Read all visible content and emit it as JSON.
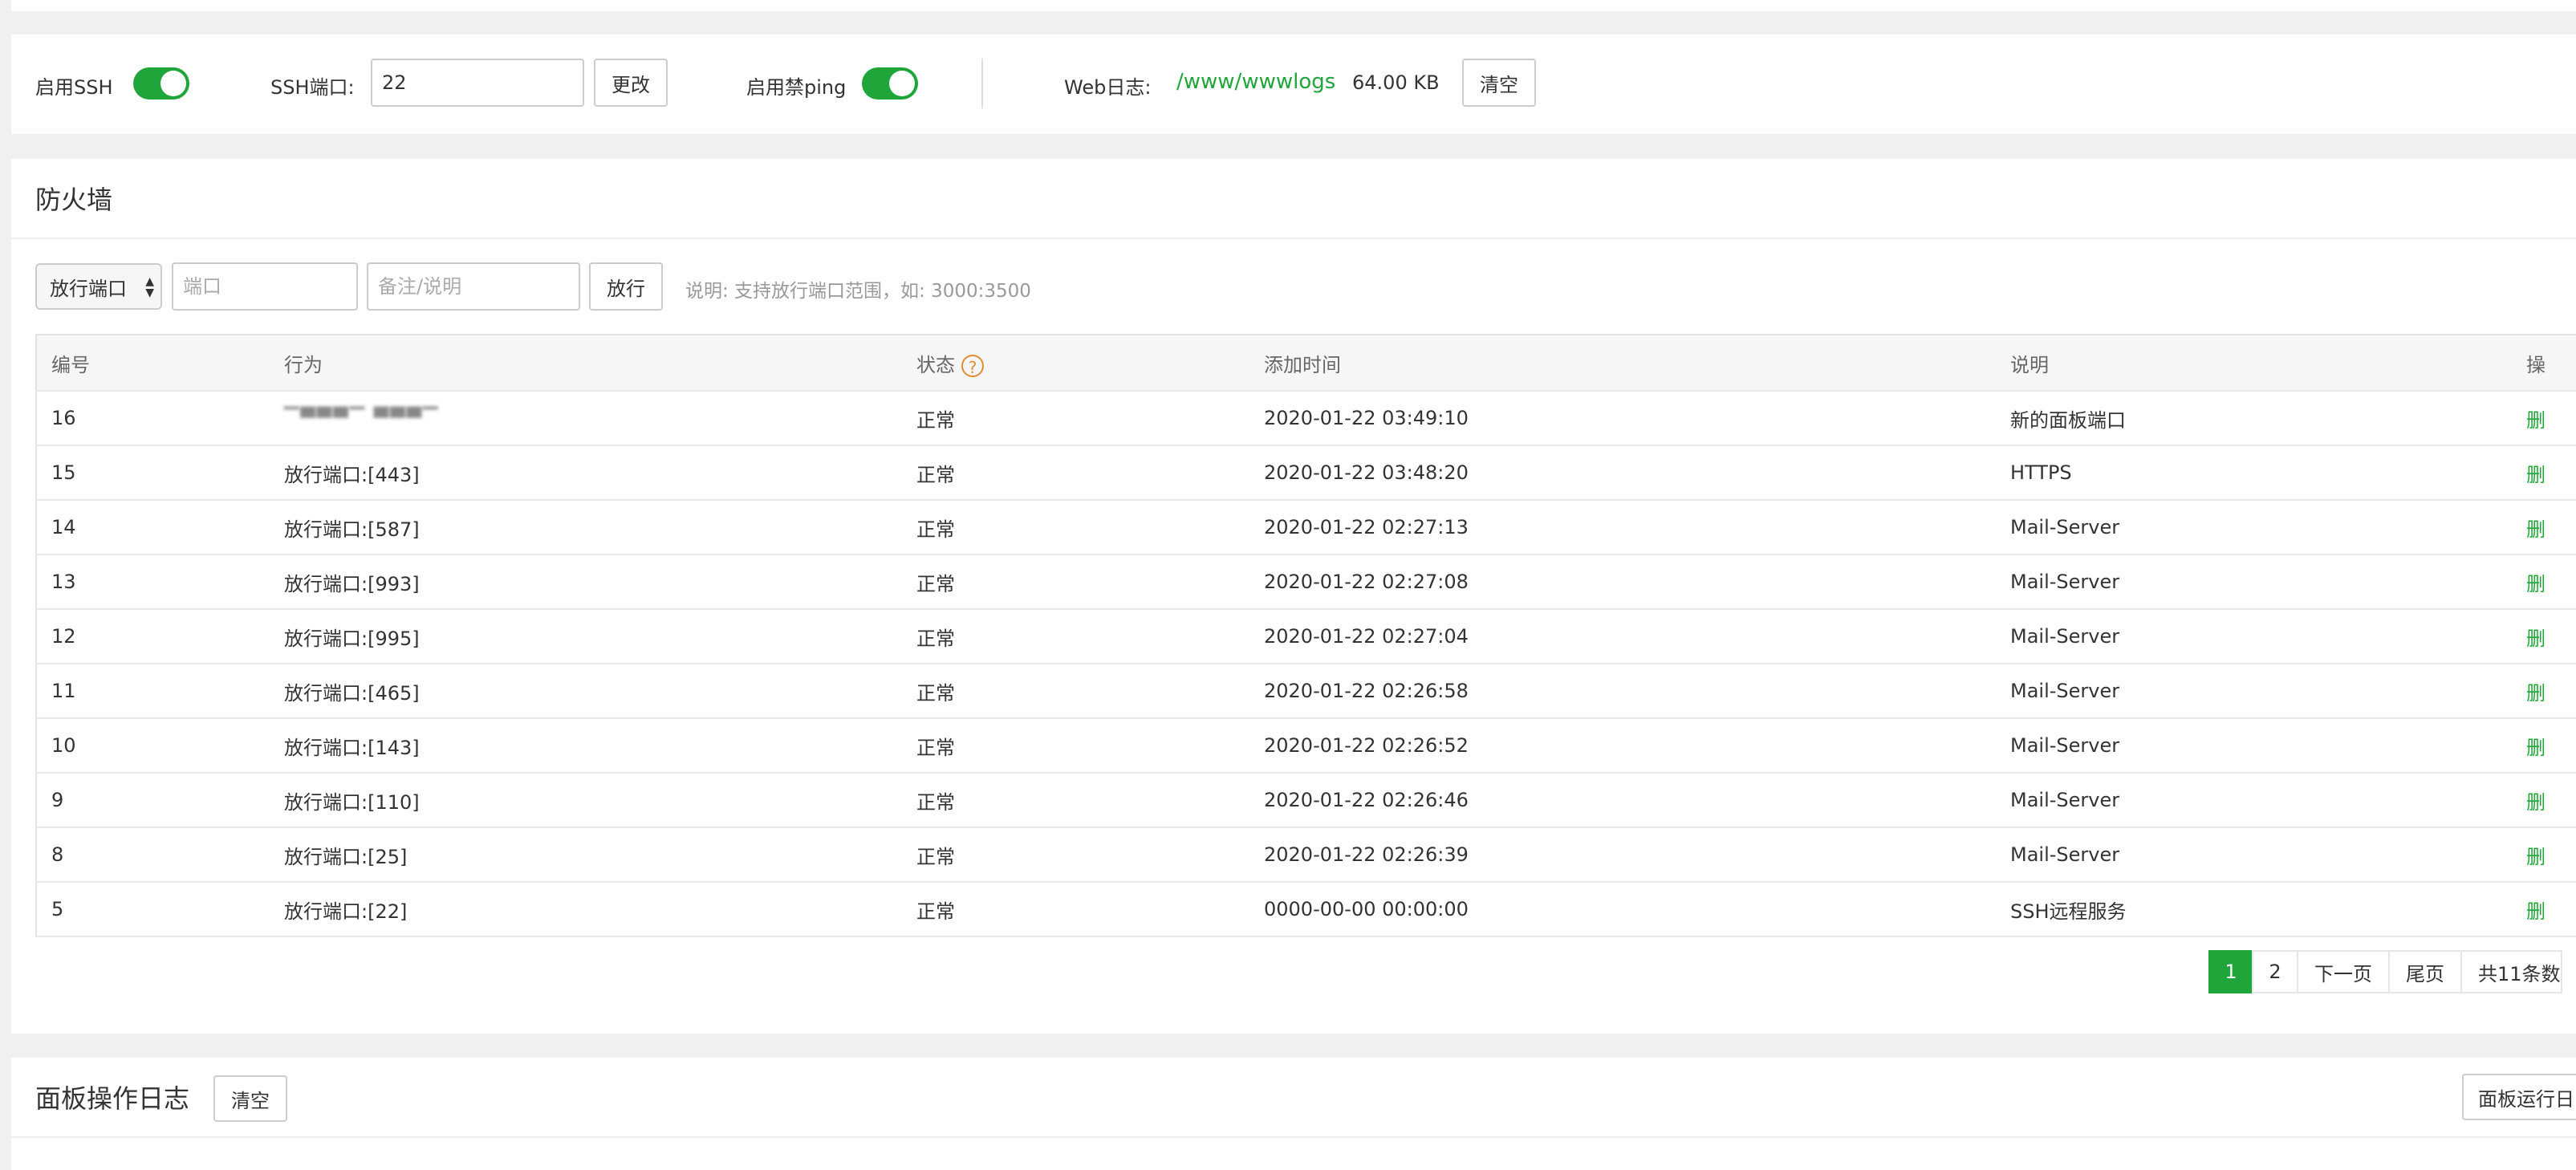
{
  "settings": {
    "ssh_label": "启用SSH",
    "ssh_enabled": true,
    "ssh_port_label": "SSH端口:",
    "ssh_port_value": "22",
    "change_button": "更改",
    "noping_label": "启用禁ping",
    "noping_enabled": true,
    "weblog_label": "Web日志:",
    "weblog_path": "/www/wwwlogs",
    "weblog_size": "64.00 KB",
    "clear_button": "清空"
  },
  "firewall": {
    "title": "防火墙",
    "select_value": "放行端口",
    "port_placeholder": "端口",
    "note_placeholder": "备注/说明",
    "allow_button": "放行",
    "hint": "说明: 支持放行端口范围，如: 3000:3500",
    "columns": [
      "编号",
      "行为",
      "状态",
      "添加时间",
      "说明",
      "操"
    ],
    "rows": [
      {
        "id": "16",
        "action": "▔▀▀▀▔ ▀▀▀▔",
        "status": "正常",
        "time": "2020-01-22 03:49:10",
        "desc": "新的面板端口",
        "op": "删"
      },
      {
        "id": "15",
        "action": "放行端口:[443]",
        "status": "正常",
        "time": "2020-01-22 03:48:20",
        "desc": "HTTPS",
        "op": "删"
      },
      {
        "id": "14",
        "action": "放行端口:[587]",
        "status": "正常",
        "time": "2020-01-22 02:27:13",
        "desc": "Mail-Server",
        "op": "删"
      },
      {
        "id": "13",
        "action": "放行端口:[993]",
        "status": "正常",
        "time": "2020-01-22 02:27:08",
        "desc": "Mail-Server",
        "op": "删"
      },
      {
        "id": "12",
        "action": "放行端口:[995]",
        "status": "正常",
        "time": "2020-01-22 02:27:04",
        "desc": "Mail-Server",
        "op": "删"
      },
      {
        "id": "11",
        "action": "放行端口:[465]",
        "status": "正常",
        "time": "2020-01-22 02:26:58",
        "desc": "Mail-Server",
        "op": "删"
      },
      {
        "id": "10",
        "action": "放行端口:[143]",
        "status": "正常",
        "time": "2020-01-22 02:26:52",
        "desc": "Mail-Server",
        "op": "删"
      },
      {
        "id": "9",
        "action": "放行端口:[110]",
        "status": "正常",
        "time": "2020-01-22 02:26:46",
        "desc": "Mail-Server",
        "op": "删"
      },
      {
        "id": "8",
        "action": "放行端口:[25]",
        "status": "正常",
        "time": "2020-01-22 02:26:39",
        "desc": "Mail-Server",
        "op": "删"
      },
      {
        "id": "5",
        "action": "放行端口:[22]",
        "status": "正常",
        "time": "0000-00-00 00:00:00",
        "desc": "SSH远程服务",
        "op": "删"
      }
    ],
    "pagination": {
      "pages": [
        "1",
        "2"
      ],
      "next": "下一页",
      "last": "尾页",
      "total": "共11条数"
    }
  },
  "panel_log": {
    "title": "面板操作日志",
    "clear_button": "清空",
    "run_log_button": "面板运行日"
  },
  "colors": {
    "accent": "#20a53a",
    "help": "#e08c35"
  }
}
